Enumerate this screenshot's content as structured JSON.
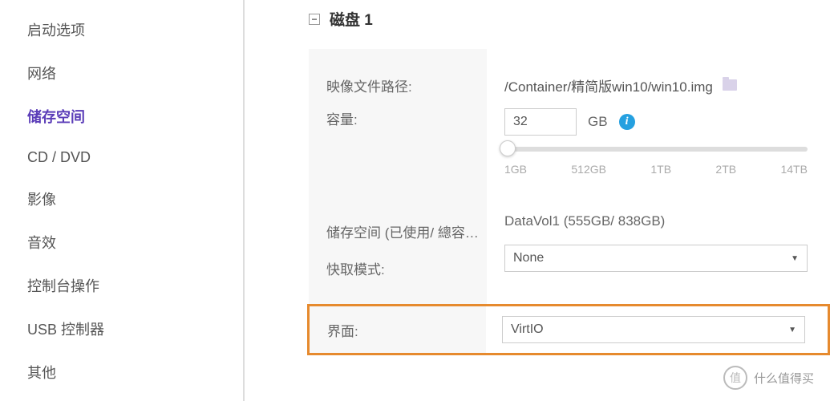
{
  "sidebar": {
    "items": [
      {
        "label": "启动选项",
        "active": false
      },
      {
        "label": "网络",
        "active": false
      },
      {
        "label": "储存空间",
        "active": true
      },
      {
        "label": "CD / DVD",
        "active": false
      },
      {
        "label": "影像",
        "active": false
      },
      {
        "label": "音效",
        "active": false
      },
      {
        "label": "控制台操作",
        "active": false
      },
      {
        "label": "USB 控制器",
        "active": false
      },
      {
        "label": "其他",
        "active": false
      }
    ]
  },
  "disk": {
    "section_title": "磁盘 1",
    "labels": {
      "image_path": "映像文件路径:",
      "capacity": "容量:",
      "storage": "储存空间 (已使用/ 總容…",
      "cache_mode": "快取模式:",
      "interface": "界面:"
    },
    "image_path": "/Container/精简版win10/win10.img",
    "capacity_value": "32",
    "capacity_unit": "GB",
    "slider_ticks": [
      "1GB",
      "512GB",
      "1TB",
      "2TB",
      "14TB"
    ],
    "storage_value": "DataVol1 (555GB/ 838GB)",
    "cache_mode_value": "None",
    "interface_value": "VirtIO"
  },
  "watermark": {
    "badge": "值",
    "text": "什么值得买"
  }
}
